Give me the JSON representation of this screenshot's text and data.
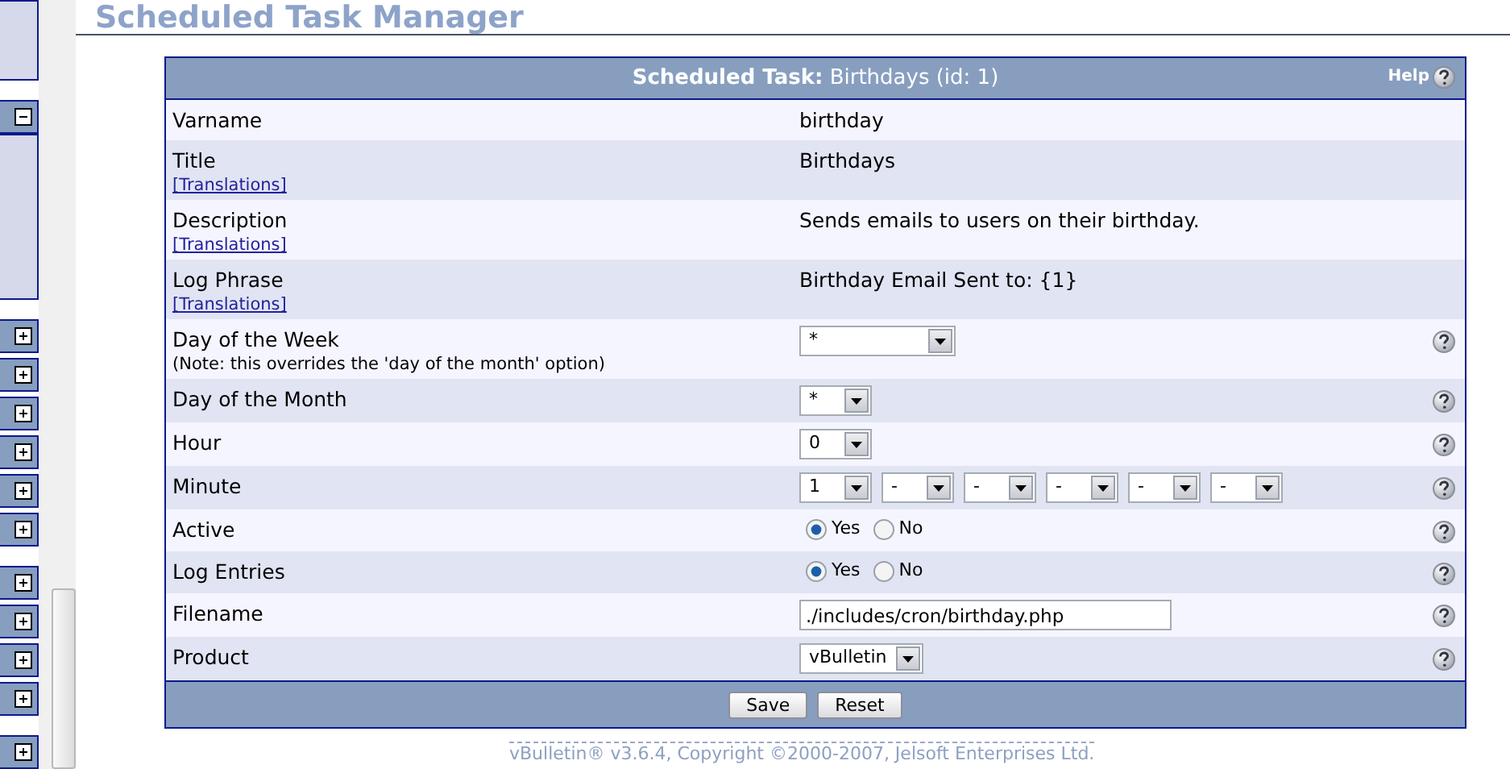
{
  "sidebar": {
    "groups": [
      [
        {
          "expanded": true
        }
      ],
      [
        {
          "expanded": false
        },
        {
          "expanded": false
        },
        {
          "expanded": false
        },
        {
          "expanded": false
        },
        {
          "expanded": false
        },
        {
          "expanded": false
        }
      ],
      [
        {
          "expanded": false
        },
        {
          "expanded": false
        },
        {
          "expanded": false
        },
        {
          "expanded": false
        }
      ],
      [
        {
          "expanded": false
        }
      ]
    ]
  },
  "page_heading": "Scheduled Task Manager",
  "form": {
    "title": "**Scheduled Task:** Birthdays (id: 1)",
    "help_label": "Help",
    "rows": [
      {
        "label": "Varname",
        "kind": "text",
        "value": "birthday",
        "help": false
      },
      {
        "label": "Title",
        "link": "[Translations]",
        "kind": "text",
        "value": "Birthdays",
        "help": false
      },
      {
        "label": "Description",
        "link": "[Translations]",
        "kind": "text",
        "value": "Sends emails to users on their birthday.",
        "help": false
      },
      {
        "label": "Log Phrase",
        "link": "[Translations]",
        "kind": "text",
        "value": "Birthday Email Sent to: {1}",
        "help": false
      },
      {
        "label": "Day of the Week",
        "note": "(Note: this overrides the 'day of the month' option)",
        "kind": "select-wide",
        "values": [
          "*"
        ],
        "help": true
      },
      {
        "label": "Day of the Month",
        "kind": "select",
        "values": [
          "*"
        ],
        "help": true
      },
      {
        "label": "Hour",
        "kind": "select",
        "values": [
          "0"
        ],
        "help": true
      },
      {
        "label": "Minute",
        "kind": "select",
        "values": [
          "1",
          "-",
          "-",
          "-",
          "-",
          "-"
        ],
        "help": true
      },
      {
        "label": "Active",
        "kind": "radio",
        "options": [
          {
            "label": "Yes",
            "selected": true
          },
          {
            "label": "No",
            "selected": false
          }
        ],
        "help": true
      },
      {
        "label": "Log Entries",
        "kind": "radio",
        "options": [
          {
            "label": "Yes",
            "selected": true
          },
          {
            "label": "No",
            "selected": false
          }
        ],
        "help": true
      },
      {
        "label": "Filename",
        "kind": "input",
        "value": "./includes/cron/birthday.php",
        "help": true
      },
      {
        "label": "Product",
        "kind": "select",
        "values": [
          "vBulletin"
        ],
        "help": true
      }
    ],
    "buttons": [
      "Save",
      "Reset"
    ]
  },
  "footer": "vBulletin® v3.6.4, Copyright ©2000-2007, Jelsoft Enterprises Ltd."
}
